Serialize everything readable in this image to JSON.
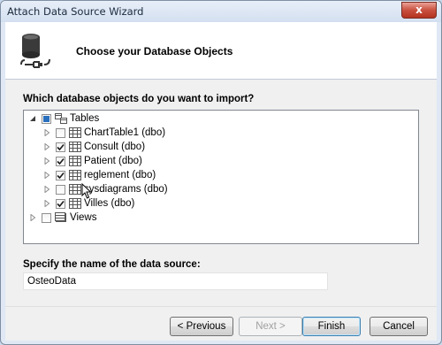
{
  "window": {
    "title": "Attach Data Source Wizard",
    "close_symbol": "x"
  },
  "header": {
    "title": "Choose your Database Objects",
    "icon": "database-plug-icon"
  },
  "objects_section": {
    "label": "Which database objects do you want to import?",
    "tree": [
      {
        "label": "Tables",
        "expanded": true,
        "state": "partial",
        "children": [
          {
            "label": "ChartTable1 (dbo)",
            "checked": false
          },
          {
            "label": "Consult (dbo)",
            "checked": true
          },
          {
            "label": "Patient (dbo)",
            "checked": true
          },
          {
            "label": "reglement (dbo)",
            "checked": true
          },
          {
            "label": "sysdiagrams (dbo)",
            "checked": false
          },
          {
            "label": "Villes (dbo)",
            "checked": true
          }
        ]
      },
      {
        "label": "Views",
        "expanded": false,
        "state": "unchecked"
      }
    ]
  },
  "name_section": {
    "label": "Specify the name of the data source:",
    "value": "OsteoData"
  },
  "buttons": {
    "previous": "< Previous",
    "next": "Next >",
    "finish": "Finish",
    "cancel": "Cancel"
  }
}
